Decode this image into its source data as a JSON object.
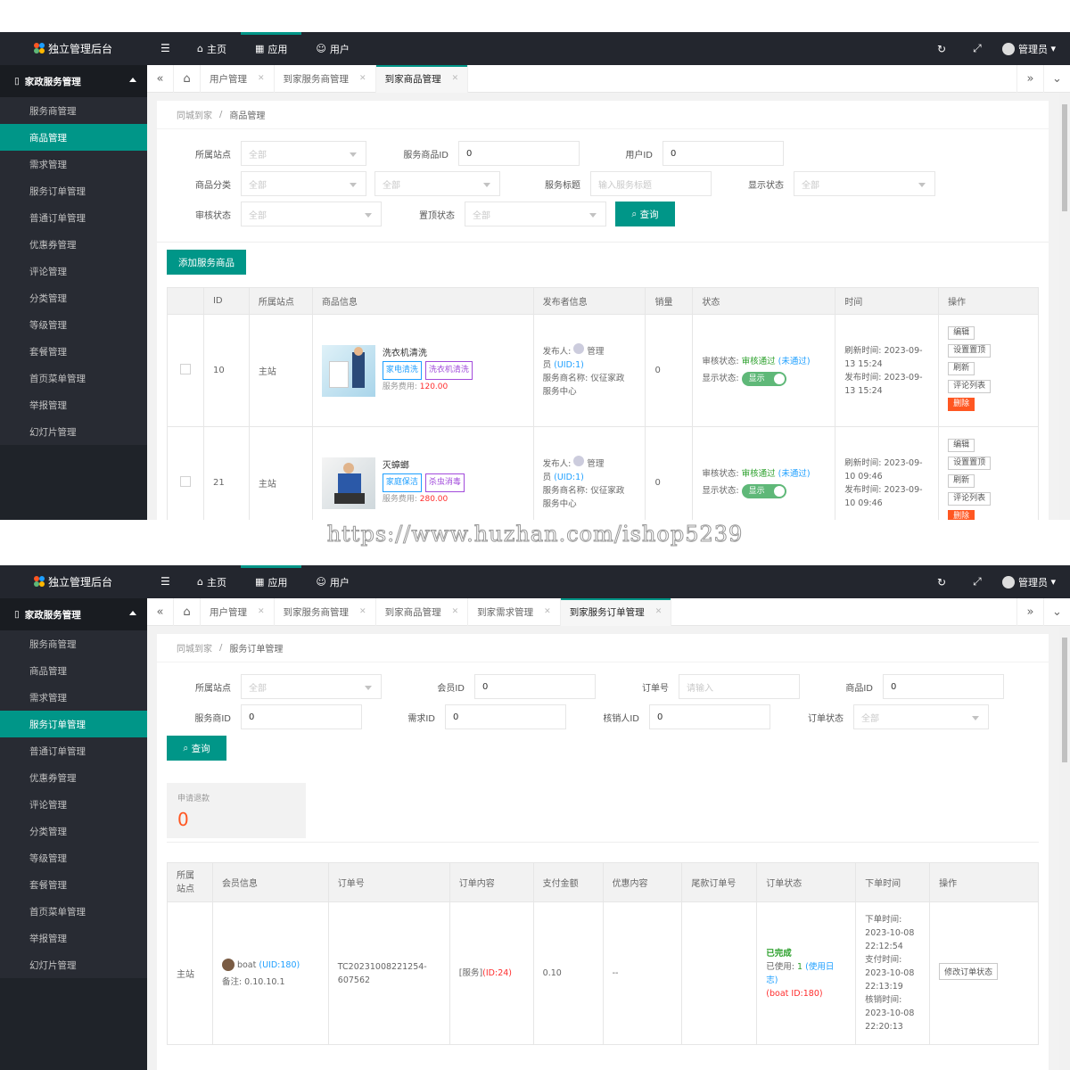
{
  "app": {
    "title": "独立管理后台",
    "menu_group": "家政服务管理"
  },
  "nav": {
    "home": "主页",
    "apps": "应用",
    "user": "用户"
  },
  "admin": "管理员",
  "sidebar": [
    "服务商管理",
    "商品管理",
    "需求管理",
    "服务订单管理",
    "普通订单管理",
    "优惠券管理",
    "评论管理",
    "分类管理",
    "等级管理",
    "套餐管理",
    "首页菜单管理",
    "举报管理",
    "幻灯片管理"
  ],
  "shot1": {
    "tabs": [
      "用户管理",
      "到家服务商管理",
      "到家商品管理"
    ],
    "breadcrumb": {
      "root": "同城到家",
      "sep": "/",
      "current": "商品管理"
    },
    "filters": {
      "station_label": "所属站点",
      "station_value": "全部",
      "service_goods_id_label": "服务商品ID",
      "service_goods_id_value": "0",
      "user_id_label": "用户ID",
      "user_id_value": "0",
      "category_label": "商品分类",
      "category_value1": "全部",
      "category_value2": "全部",
      "title_label": "服务标题",
      "title_placeholder": "输入服务标题",
      "display_label": "显示状态",
      "display_value": "全部",
      "audit_label": "审核状态",
      "audit_value": "全部",
      "top_label": "置顶状态",
      "top_value": "全部",
      "query": "查询"
    },
    "add_button": "添加服务商品",
    "columns": [
      "ID",
      "所属站点",
      "商品信息",
      "发布者信息",
      "销量",
      "状态",
      "时间",
      "操作"
    ],
    "rows": [
      {
        "id": "10",
        "station": "主站",
        "name": "洗衣机清洗",
        "tag1": "家电清洗",
        "tag2": "洗衣机清洗",
        "fee_label": "服务费用:",
        "fee": "120.00",
        "publisher_label": "发布人:",
        "publisher": "管理",
        "publisher2": "员",
        "uid": "(UID:1)",
        "provider_label": "服务商名称:",
        "provider": "仪征家政",
        "provider2": "服务中心",
        "sales": "0",
        "audit_label": "审核状态:",
        "audit": "审核通过",
        "audit_alt": "(未通过)",
        "display_label": "显示状态:",
        "display": "显示",
        "refresh_label": "刷新时间:",
        "refresh": "2023-09-",
        "refresh2": "13 15:24",
        "publish_label": "发布时间:",
        "publish": "2023-09-",
        "publish2": "13 15:24"
      },
      {
        "id": "21",
        "station": "主站",
        "name": "灭蟑螂",
        "tag1": "家庭保洁",
        "tag2": "杀虫消毒",
        "fee_label": "服务费用:",
        "fee": "280.00",
        "publisher_label": "发布人:",
        "publisher": "管理",
        "publisher2": "员",
        "uid": "(UID:1)",
        "provider_label": "服务商名称:",
        "provider": "仪征家政",
        "provider2": "服务中心",
        "sales": "0",
        "audit_label": "审核状态:",
        "audit": "审核通过",
        "audit_alt": "(未通过)",
        "display_label": "显示状态:",
        "display": "显示",
        "refresh_label": "刷新时间:",
        "refresh": "2023-09-",
        "refresh2": "10 09:46",
        "publish_label": "发布时间:",
        "publish": "2023-09-",
        "publish2": "10 09:46"
      }
    ],
    "ops": [
      "编辑",
      "设置置顶",
      "刷新",
      "评论列表",
      "删除"
    ]
  },
  "watermark": "https://www.huzhan.com/ishop5239",
  "shot2": {
    "tabs": [
      "用户管理",
      "到家服务商管理",
      "到家商品管理",
      "到家需求管理",
      "到家服务订单管理"
    ],
    "breadcrumb": {
      "root": "同城到家",
      "sep": "/",
      "current": "服务订单管理"
    },
    "filters": {
      "station_label": "所属站点",
      "station_value": "全部",
      "member_id_label": "会员ID",
      "member_id_value": "0",
      "order_no_label": "订单号",
      "order_no_placeholder": "请输入",
      "goods_id_label": "商品ID",
      "goods_id_value": "0",
      "provider_id_label": "服务商ID",
      "provider_id_value": "0",
      "demand_id_label": "需求ID",
      "demand_id_value": "0",
      "verifier_id_label": "核销人ID",
      "verifier_id_value": "0",
      "order_status_label": "订单状态",
      "order_status_value": "全部",
      "query": "查询"
    },
    "stat": {
      "label": "申请退款",
      "value": "0"
    },
    "columns": [
      "所属\n站点",
      "会员信息",
      "订单号",
      "订单内容",
      "支付金额",
      "优惠内容",
      "尾款订单号",
      "订单状态",
      "下单时间",
      "操作"
    ],
    "row": {
      "station": "主站",
      "member": "boat",
      "member_uid": "(UID:180)",
      "remark_label": "备注:",
      "remark": "0.10.10.1",
      "order_no": "TC20231008221254-",
      "order_no2": "607562",
      "content": "[服务]",
      "content_id": "(ID:24)",
      "amount": "0.10",
      "discount": "--",
      "status": "已完成",
      "used_label": "已使用:",
      "used": "1",
      "used_link": "(使用日",
      "used_link2": "志)",
      "used_by": "(boat ID:180)",
      "order_time_label": "下单时间:",
      "order_time": "2023-10-08",
      "order_time2": "22:12:54",
      "pay_time_label": "支付时间:",
      "pay_time": "2023-10-08",
      "pay_time2": "22:13:19",
      "verify_time_label": "核销时间:",
      "verify_time": "2023-10-08",
      "verify_time2": "22:20:13",
      "op": "修改订单状态"
    }
  },
  "colors": {
    "accent": "#009688",
    "topbar": "#23262e",
    "sidebar": "#282b33",
    "danger": "#ff5722"
  }
}
